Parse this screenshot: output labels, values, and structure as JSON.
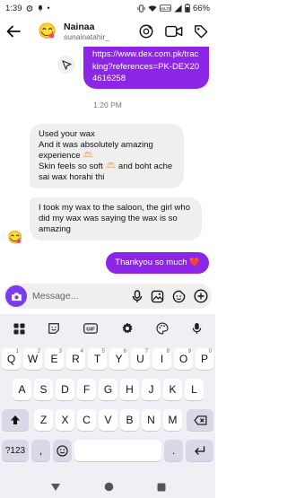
{
  "status_bar": {
    "time": "1:39",
    "battery": "66%"
  },
  "header": {
    "name": "Nainaa",
    "username": "sunainatahir_"
  },
  "messages": {
    "link_text": "https://www.dex.com.pk/tracking?references=PK-DEX204616258",
    "timestamp": "1:20 PM",
    "in1_lines": [
      "Used your wax",
      "And it was absolutely amazing experience 🫶🏻",
      "Skin feels so soft 🫶🏻 and boht ache sai wax horahi thi"
    ],
    "in2_text": "I took my wax to the saloon, the girl who did my wax was saying the wax is so amazing",
    "out_text": "Thankyou so much ❤️"
  },
  "composer": {
    "placeholder": "Message..."
  },
  "keyboard": {
    "row1": [
      {
        "k": "Q",
        "h": "1"
      },
      {
        "k": "W",
        "h": "2"
      },
      {
        "k": "E",
        "h": "3"
      },
      {
        "k": "R",
        "h": "4"
      },
      {
        "k": "T",
        "h": "5"
      },
      {
        "k": "Y",
        "h": "6"
      },
      {
        "k": "U",
        "h": "7"
      },
      {
        "k": "I",
        "h": "8"
      },
      {
        "k": "O",
        "h": "9"
      },
      {
        "k": "P",
        "h": "0"
      }
    ],
    "row2": [
      "A",
      "S",
      "D",
      "F",
      "G",
      "H",
      "J",
      "K",
      "L"
    ],
    "row3": [
      "Z",
      "X",
      "C",
      "V",
      "B",
      "N",
      "M"
    ],
    "symbols_key": "?123",
    "comma_key": ",",
    "period_key": "."
  },
  "colors": {
    "outgoing": "#8c25e6",
    "incoming": "#efefef",
    "camera": "#7b3cf0"
  }
}
